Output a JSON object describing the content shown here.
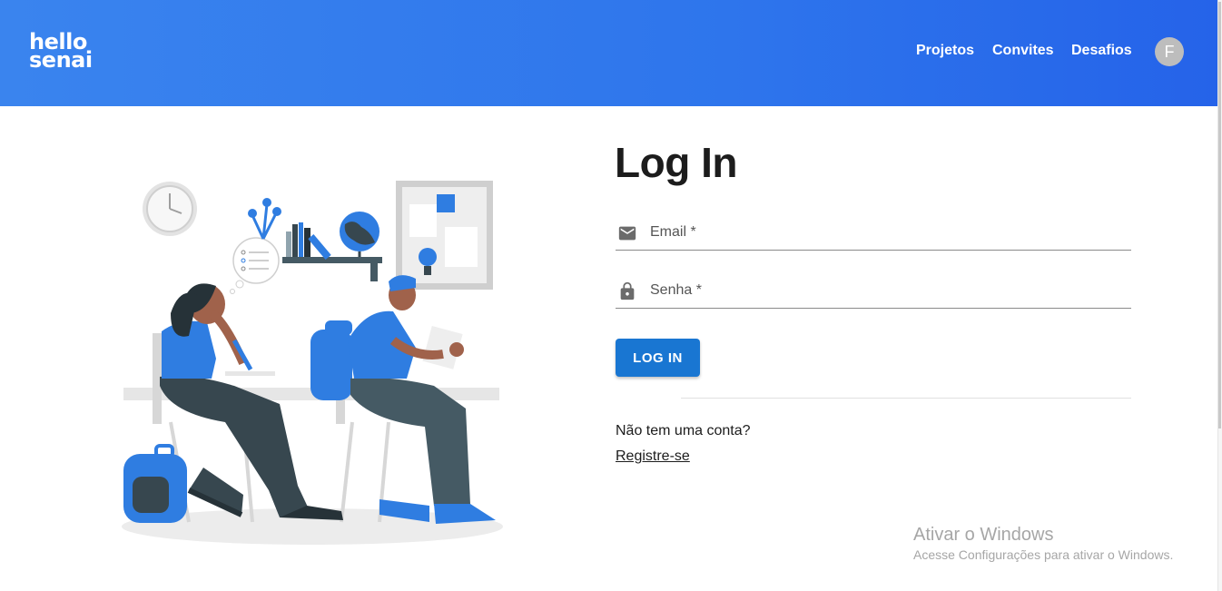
{
  "header": {
    "logo_line1": "hello",
    "logo_line2": "senai",
    "nav": [
      "Projetos",
      "Convites",
      "Desafios"
    ],
    "avatar_initial": "F",
    "gradient": [
      "#3a84ee",
      "#2563e9"
    ]
  },
  "login": {
    "title": "Log In",
    "email_placeholder": "Email *",
    "password_placeholder": "Senha *",
    "submit_label": "LOG IN",
    "no_account": "Não tem uma conta?",
    "register_link": "Registre-se"
  },
  "watermark": {
    "title": "Ativar o Windows",
    "subtitle": "Acesse Configurações para ativar o Windows."
  },
  "colors": {
    "accent": "#1976d2",
    "illustration_blue": "#2f7de1",
    "illustration_dark": "#37474f"
  }
}
